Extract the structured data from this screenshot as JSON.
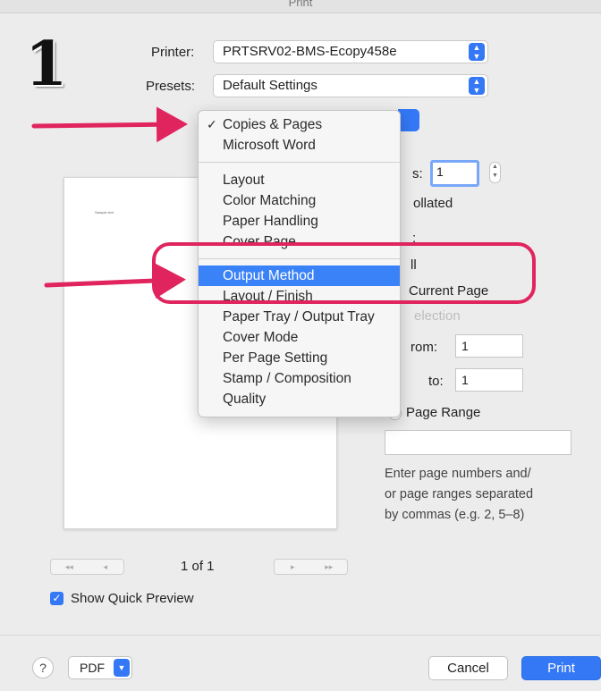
{
  "window": {
    "title": "Print"
  },
  "step_number": "1",
  "printer": {
    "label": "Printer:",
    "value": "PRTSRV02-BMS-Ecopy458e"
  },
  "presets": {
    "label": "Presets:",
    "value": "Default Settings"
  },
  "menu": {
    "items": [
      {
        "label": "Copies & Pages",
        "checked": true
      },
      {
        "label": "Microsoft Word"
      },
      {
        "label": "Layout"
      },
      {
        "label": "Color Matching"
      },
      {
        "label": "Paper Handling"
      },
      {
        "label": "Cover Page"
      },
      {
        "label": "Output Method",
        "selected": true
      },
      {
        "label": "Layout / Finish"
      },
      {
        "label": "Paper Tray / Output Tray"
      },
      {
        "label": "Cover Mode"
      },
      {
        "label": "Per Page Setting"
      },
      {
        "label": "Stamp / Composition"
      },
      {
        "label": "Quality"
      }
    ],
    "check_mark": "✓"
  },
  "copies": {
    "label_fragment": "s:",
    "value": "1",
    "collated_fragment": "ollated"
  },
  "pages": {
    "label_fragment": ":",
    "all_fragment": "ll",
    "current_fragment": "Current Page",
    "selection_fragment": "election",
    "from_label": "rom:",
    "from_value": "1",
    "to_label": "to:",
    "to_value": "1",
    "page_range_label": "Page Range",
    "page_range_value": "",
    "hint": [
      "Enter page numbers and/",
      "or page ranges separated",
      "by commas (e.g. 2, 5–8)"
    ]
  },
  "preview": {
    "page_counter": "1 of 1",
    "tiny_text": "Sample text",
    "nav_first": "◂◂",
    "nav_prev": "◂",
    "nav_next": "▸",
    "nav_last": "▸▸"
  },
  "show_quick_preview": {
    "label": "Show Quick Preview",
    "checked": true
  },
  "bottom": {
    "help": "?",
    "pdf": "PDF",
    "cancel": "Cancel",
    "print": "Print"
  },
  "colors": {
    "accent": "#3478f6",
    "annotation": "#e0245e"
  }
}
